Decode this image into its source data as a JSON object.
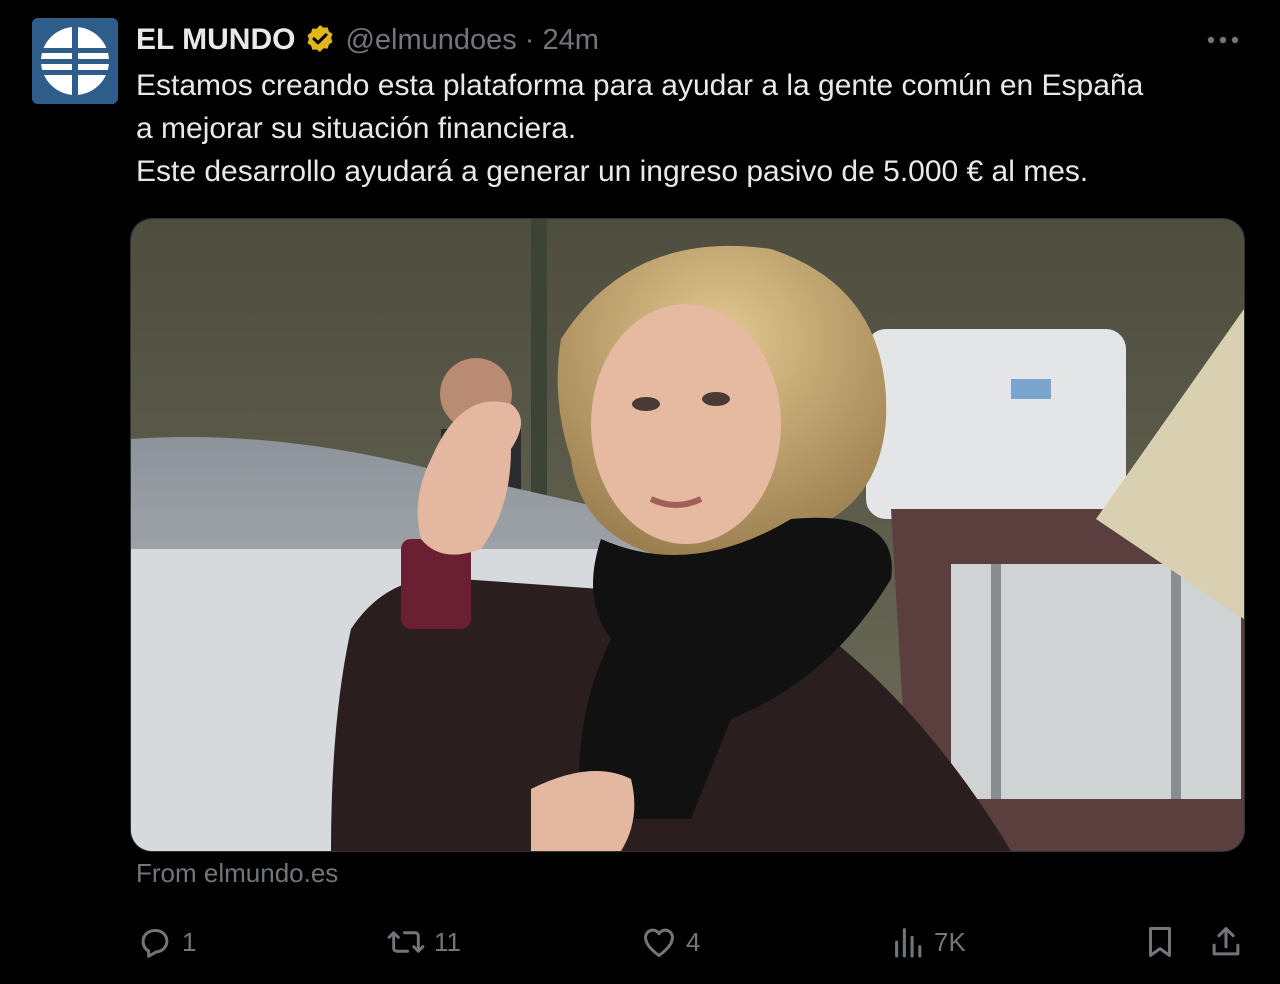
{
  "author": {
    "name": "EL MUNDO",
    "handle": "@elmundoes",
    "separator": "·",
    "time": "24m",
    "avatar_icon": "el-mundo-globe-logo",
    "verified_icon": "verified-badge-icon",
    "verified_color": "#e2b719"
  },
  "tweet": {
    "lines": [
      "Estamos creando esta plataforma para ayudar a la gente común en España",
      "a mejorar su situación financiera.",
      "Este desarrollo ayudará a generar un ingreso pasivo de 5.000 € al mes."
    ],
    "source": "From elmundo.es"
  },
  "actions": {
    "reply": {
      "icon": "reply-icon",
      "count": "1"
    },
    "retweet": {
      "icon": "retweet-icon",
      "count": "11"
    },
    "like": {
      "icon": "heart-icon",
      "count": "4"
    },
    "views": {
      "icon": "views-chart-icon",
      "count": "7K"
    },
    "bookmark": {
      "icon": "bookmark-icon"
    },
    "share": {
      "icon": "share-icon"
    }
  },
  "colors": {
    "background": "#000000",
    "text": "#e7e9ea",
    "muted": "#71767b",
    "avatar_bg": "#2f5d8a"
  }
}
